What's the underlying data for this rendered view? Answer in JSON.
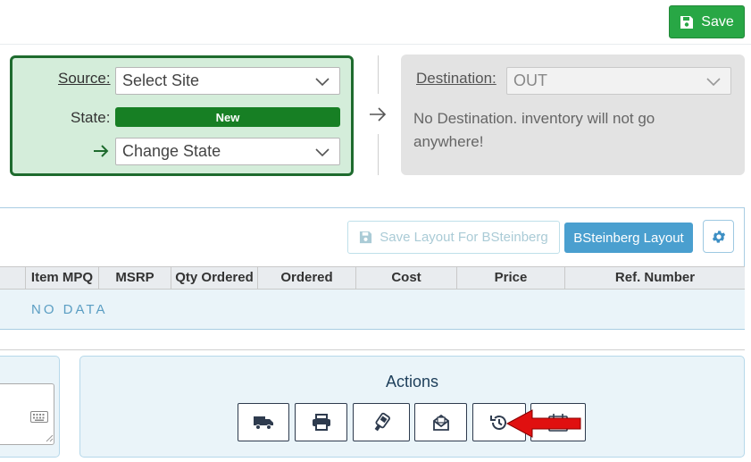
{
  "toolbar": {
    "save_label": "Save"
  },
  "source": {
    "source_label": "Source:",
    "site_select_value": "Select Site",
    "state_label": "State:",
    "state_value": "New",
    "change_state_value": "Change State"
  },
  "destination": {
    "label": "Destination:",
    "select_value": "OUT",
    "message": "No Destination. inventory will not go anywhere!"
  },
  "grid": {
    "save_layout_label": "Save Layout For BSteinberg",
    "layout_label": "BSteinberg Layout",
    "columns": [
      "Item MPQ",
      "MSRP",
      "Qty Ordered",
      "Ordered",
      "Cost",
      "Price",
      "Ref. Number"
    ],
    "empty_text": "NO DATA"
  },
  "actions": {
    "title": "Actions",
    "buttons": [
      "truck-icon",
      "print-icon",
      "scan-icon",
      "mail-open-icon",
      "history-icon",
      "calendar-icon"
    ]
  },
  "colors": {
    "save": "#28a745",
    "state_badge": "#177f24",
    "source_bg": "#d4edda",
    "source_border": "#1e6b2e",
    "layout_button": "#4a9fcf",
    "annotation_arrow": "#e01010"
  }
}
